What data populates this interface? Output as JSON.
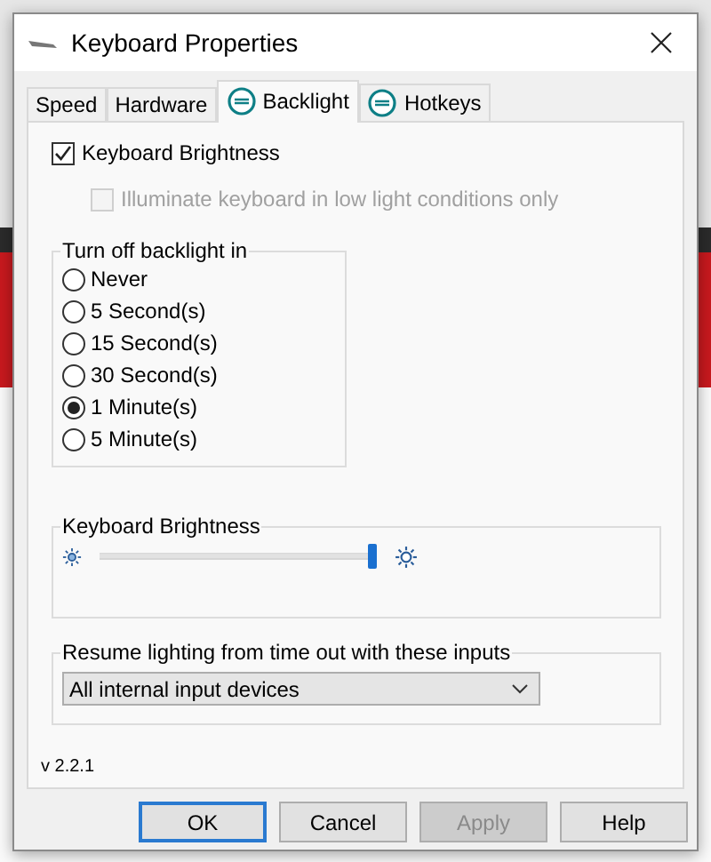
{
  "window": {
    "title": "Keyboard Properties"
  },
  "tabs": [
    {
      "label": "Speed",
      "selected": false,
      "logo": false
    },
    {
      "label": "Hardware",
      "selected": false,
      "logo": false
    },
    {
      "label": "Backlight",
      "selected": true,
      "logo": true
    },
    {
      "label": "Hotkeys",
      "selected": false,
      "logo": true
    }
  ],
  "brightness_toggle": {
    "label": "Keyboard Brightness",
    "checked": true,
    "disabled": false
  },
  "low_light_option": {
    "label": "Illuminate keyboard in low light conditions only",
    "checked": false,
    "disabled": true
  },
  "timeout": {
    "title": "Turn off backlight in",
    "options": [
      {
        "label": "Never",
        "selected": false
      },
      {
        "label": "5 Second(s)",
        "selected": false
      },
      {
        "label": "15 Second(s)",
        "selected": false
      },
      {
        "label": "30 Second(s)",
        "selected": false
      },
      {
        "label": "1 Minute(s)",
        "selected": true
      },
      {
        "label": "5 Minute(s)",
        "selected": false
      }
    ]
  },
  "brightness": {
    "title": "Keyboard Brightness",
    "level": 1
  },
  "resume": {
    "title": "Resume lighting from time out with these inputs",
    "value": "All internal input devices"
  },
  "version": "v 2.2.1",
  "buttons": [
    {
      "label": "OK",
      "default": true,
      "disabled": false
    },
    {
      "label": "Cancel",
      "default": false,
      "disabled": false
    },
    {
      "label": "Apply",
      "default": false,
      "disabled": true
    },
    {
      "label": "Help",
      "default": false,
      "disabled": false
    }
  ]
}
